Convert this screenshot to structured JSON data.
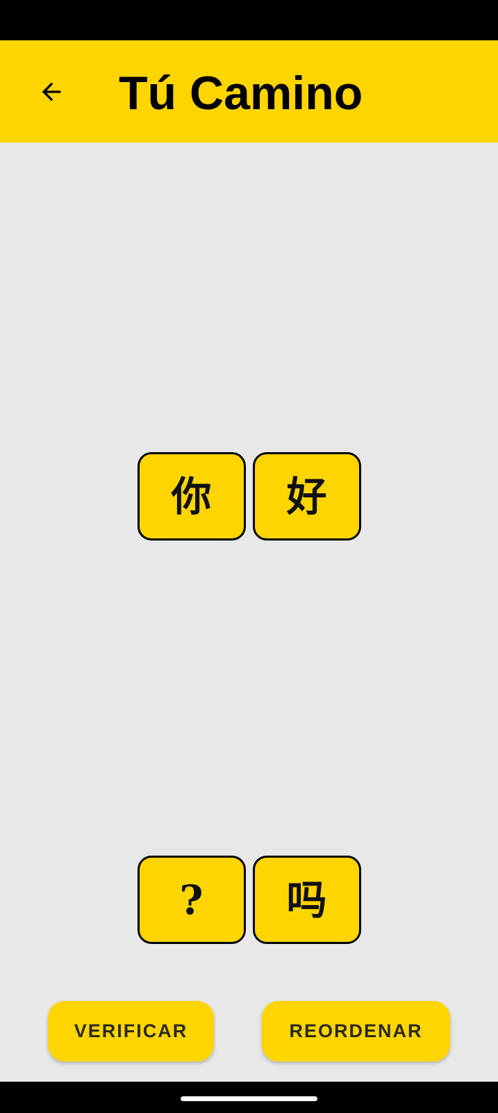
{
  "app_bar": {
    "title": "Tú Camino",
    "back_icon": "arrow-left-icon"
  },
  "answer_tiles": [
    {
      "char": "你"
    },
    {
      "char": "好"
    }
  ],
  "bank_tiles": [
    {
      "char": "?"
    },
    {
      "char": "吗"
    }
  ],
  "actions": {
    "verify_label": "VERIFICAR",
    "reorder_label": "REORDENAR"
  },
  "colors": {
    "accent": "#FFD500",
    "background": "#E8E8E8",
    "text": "#000000"
  }
}
